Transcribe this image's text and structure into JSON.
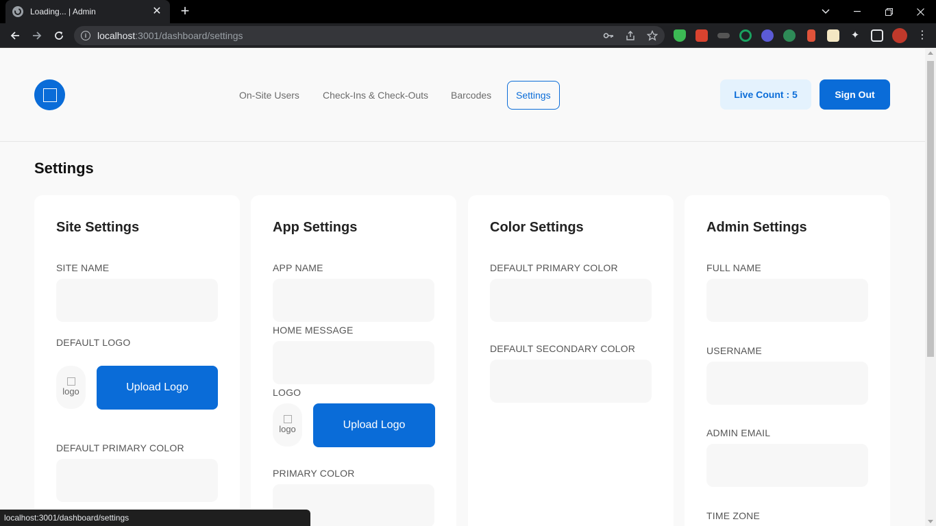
{
  "browser": {
    "tab_title": "Loading... | Admin",
    "url_host": "localhost",
    "url_rest": ":3001/dashboard/settings",
    "status_url": "localhost:3001/dashboard/settings",
    "extension_icons": [
      "shield-icon",
      "puzzle-game-icon",
      "car-icon",
      "target-icon",
      "flower-icon",
      "gem-icon",
      "rocket-icon",
      "note-icon",
      "extensions-icon",
      "sidepanel-icon",
      "profile-avatar",
      "menu-icon"
    ]
  },
  "header": {
    "nav": [
      {
        "label": "On-Site Users",
        "active": false
      },
      {
        "label": "Check-Ins & Check-Outs",
        "active": false
      },
      {
        "label": "Barcodes",
        "active": false
      },
      {
        "label": "Settings",
        "active": true
      }
    ],
    "live_count": "Live Count : 5",
    "sign_out": "Sign Out"
  },
  "page": {
    "title": "Settings"
  },
  "cards": {
    "site": {
      "title": "Site Settings",
      "site_name_label": "SITE NAME",
      "site_name_value": "",
      "default_logo_label": "DEFAULT LOGO",
      "logo_alt": "logo",
      "upload_label": "Upload Logo",
      "primary_color_label": "DEFAULT PRIMARY COLOR",
      "primary_color_value": ""
    },
    "app": {
      "title": "App Settings",
      "app_name_label": "APP NAME",
      "app_name_value": "",
      "home_message_label": "HOME MESSAGE",
      "home_message_value": "",
      "logo_label": "LOGO",
      "logo_alt": "logo",
      "upload_label": "Upload Logo",
      "primary_color_label": "PRIMARY COLOR",
      "primary_color_value": ""
    },
    "color": {
      "title": "Color Settings",
      "primary_label": "DEFAULT PRIMARY COLOR",
      "primary_value": "",
      "secondary_label": "DEFAULT SECONDARY COLOR",
      "secondary_value": ""
    },
    "admin": {
      "title": "Admin Settings",
      "full_name_label": "FULL NAME",
      "full_name_value": "",
      "username_label": "USERNAME",
      "username_value": "",
      "email_label": "ADMIN EMAIL",
      "email_value": "",
      "timezone_label": "TIME ZONE"
    }
  },
  "colors": {
    "accent": "#0a6cd8",
    "live_count_bg": "#e4f2fd",
    "page_bg": "#f9f9f9",
    "card_bg": "#ffffff",
    "input_bg": "#f7f7f7"
  }
}
